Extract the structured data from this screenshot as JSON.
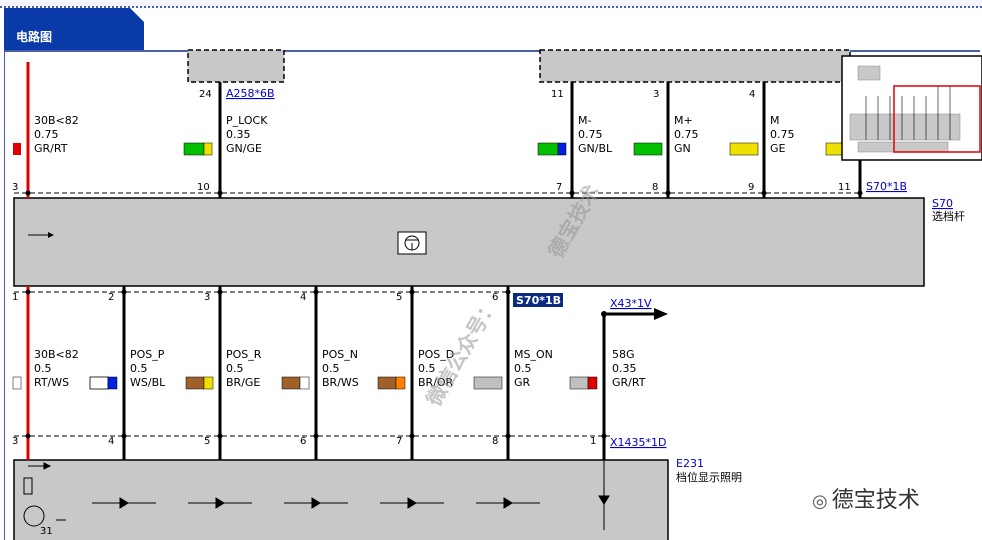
{
  "tab": {
    "title": "电路图"
  },
  "top_connectors": {
    "left_pin": "24",
    "left_ref": "A258*6B",
    "right_pins": [
      "11",
      "3",
      "4"
    ]
  },
  "upper_wires": [
    {
      "signal": "30B<82",
      "gauge": "0.75",
      "color_code": "GR/RT",
      "bottom_pin": "3"
    },
    {
      "signal": "P_LOCK",
      "gauge": "0.35",
      "color_code": "GN/GE",
      "bottom_pin": "10"
    },
    {
      "signal": "M-",
      "gauge": "0.75",
      "color_code": "GN/BL",
      "bottom_pin": "7"
    },
    {
      "signal": "M+",
      "gauge": "0.75",
      "color_code": "GN",
      "bottom_pin": "8"
    },
    {
      "signal": "M",
      "gauge": "0.75",
      "color_code": "GE",
      "bottom_pin": "9"
    }
  ],
  "upper_connector": {
    "last_pin": "11",
    "ref": "S70*1B"
  },
  "module_s70": {
    "ref": "S70",
    "name": "选档杆"
  },
  "middle_connector": {
    "pins": [
      "1",
      "2",
      "3",
      "4",
      "5",
      "6"
    ],
    "ref": "S70*1B",
    "out_ref": "X43*1V"
  },
  "lower_wires": [
    {
      "signal": "30B<82",
      "gauge": "0.5",
      "color_code": "RT/WS",
      "bottom_pin": "3"
    },
    {
      "signal": "POS_P",
      "gauge": "0.5",
      "color_code": "WS/BL",
      "bottom_pin": "4"
    },
    {
      "signal": "POS_R",
      "gauge": "0.5",
      "color_code": "BR/GE",
      "bottom_pin": "5"
    },
    {
      "signal": "POS_N",
      "gauge": "0.5",
      "color_code": "BR/WS",
      "bottom_pin": "6"
    },
    {
      "signal": "POS_D",
      "gauge": "0.5",
      "color_code": "BR/OR",
      "bottom_pin": "7"
    },
    {
      "signal": "MS_ON",
      "gauge": "0.5",
      "color_code": "GR",
      "bottom_pin": "8"
    },
    {
      "signal": "58G",
      "gauge": "0.35",
      "color_code": "GR/RT",
      "bottom_pin": "1"
    }
  ],
  "lower_connector": {
    "ref": "X1435*1D"
  },
  "module_e231": {
    "ref": "E231",
    "name": "档位显示照明",
    "ground_pin": "31"
  },
  "watermarks": {
    "line1": "德宝技术",
    "line2": "微信公众号："
  },
  "brand": {
    "name": "德宝技术"
  },
  "colors": {
    "accent": "#0a3aa8",
    "wire_red": "#e00000",
    "wire_black": "#000000",
    "module_fill": "#c8c8c8"
  }
}
